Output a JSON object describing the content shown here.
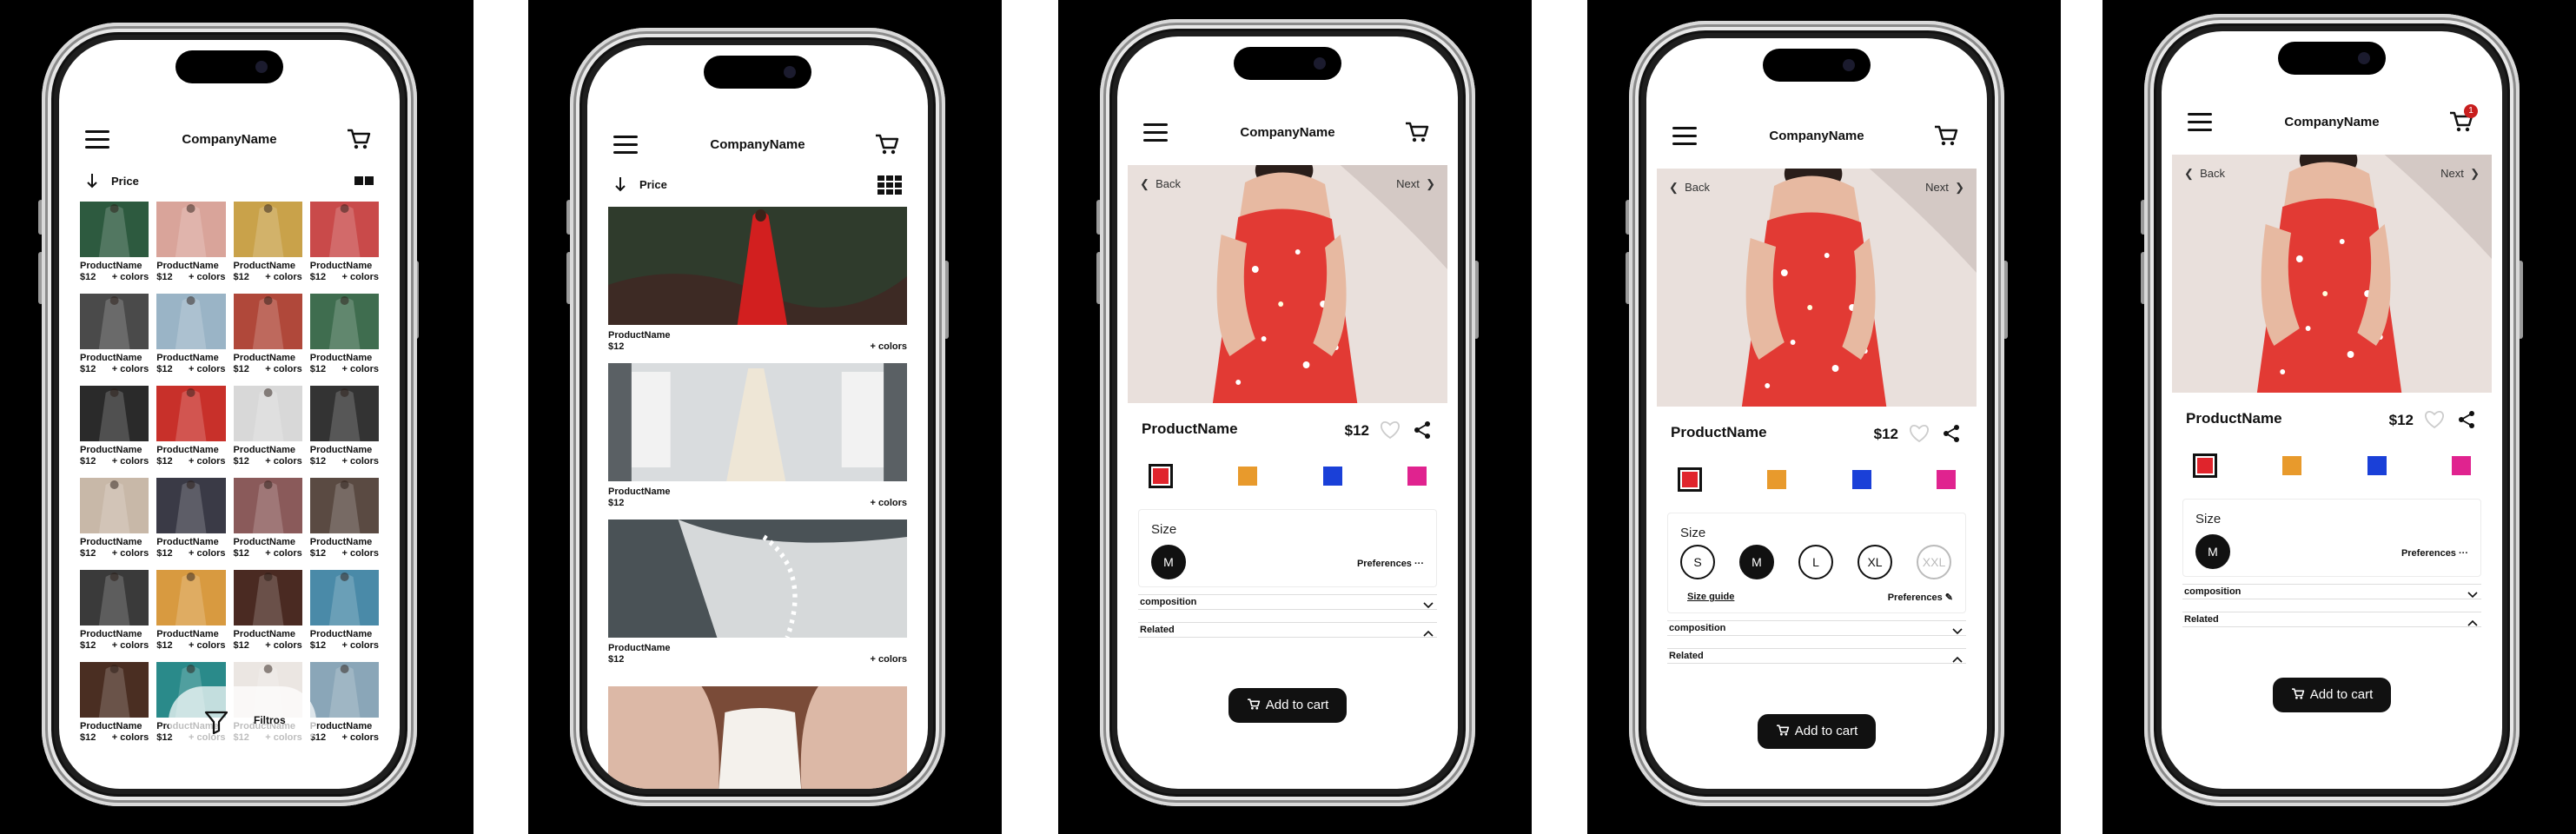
{
  "app": {
    "company": "CompanyName"
  },
  "colors": {
    "red": "#e0242c",
    "orange": "#e89a2c",
    "blue": "#1a40d8",
    "pink": "#e0238f"
  },
  "catalog": {
    "sort_label": "Price",
    "filter_label": "Filtros",
    "rows": [
      [
        {
          "name": "ProductName",
          "price": "$12",
          "colors": "+ colors",
          "bg": "#2d5a3f"
        },
        {
          "name": "ProductName",
          "price": "$12",
          "colors": "+ colors",
          "bg": "#d9a49a"
        },
        {
          "name": "ProductName",
          "price": "$12",
          "colors": "+ colors",
          "bg": "#c9a24a"
        },
        {
          "name": "ProductName",
          "price": "$12",
          "colors": "+ colors",
          "bg": "#c94a4a"
        }
      ],
      [
        {
          "name": "ProductName",
          "price": "$12",
          "colors": "+ colors",
          "bg": "#4a4a4a"
        },
        {
          "name": "ProductName",
          "price": "$12",
          "colors": "+ colors",
          "bg": "#9ab4c6"
        },
        {
          "name": "ProductName",
          "price": "$12",
          "colors": "+ colors",
          "bg": "#b0483a"
        },
        {
          "name": "ProductName",
          "price": "$12",
          "colors": "+ colors",
          "bg": "#3f6d4f"
        }
      ],
      [
        {
          "name": "ProductName",
          "price": "$12",
          "colors": "+ colors",
          "bg": "#2a2a2a"
        },
        {
          "name": "ProductName",
          "price": "$12",
          "colors": "+ colors",
          "bg": "#c8302a"
        },
        {
          "name": "ProductName",
          "price": "$12",
          "colors": "+ colors",
          "bg": "#d8d8d8"
        },
        {
          "name": "ProductName",
          "price": "$12",
          "colors": "+ colors",
          "bg": "#333333"
        }
      ],
      [
        {
          "name": "ProductName",
          "price": "$12",
          "colors": "+ colors",
          "bg": "#c8b8a8"
        },
        {
          "name": "ProductName",
          "price": "$12",
          "colors": "+ colors",
          "bg": "#3a3a46"
        },
        {
          "name": "ProductName",
          "price": "$12",
          "colors": "+ colors",
          "bg": "#8a5a5a"
        },
        {
          "name": "ProductName",
          "price": "$12",
          "colors": "+ colors",
          "bg": "#5a4a42"
        }
      ],
      [
        {
          "name": "ProductName",
          "price": "$12",
          "colors": "+ colors",
          "bg": "#3a3a3a"
        },
        {
          "name": "ProductName",
          "price": "$12",
          "colors": "+ colors",
          "bg": "#d89a40"
        },
        {
          "name": "ProductName",
          "price": "$12",
          "colors": "+ colors",
          "bg": "#4a2a22"
        },
        {
          "name": "ProductName",
          "price": "$12",
          "colors": "+ colors",
          "bg": "#4a8aa8"
        }
      ],
      [
        {
          "name": "ProductName",
          "price": "$12",
          "colors": "+ colors",
          "bg": "#4a2e22"
        },
        {
          "name": "ProductName",
          "price": "$12",
          "colors": "+ colors",
          "bg": "#2a8a8a"
        },
        {
          "name": "ProductName",
          "price": "$12",
          "colors": "+ colors",
          "bg": "#ebe6e2"
        },
        {
          "name": "ProductName",
          "price": "$12",
          "colors": "+ colors",
          "bg": "#8aa6b8"
        }
      ]
    ]
  },
  "list": {
    "sort_label": "Price",
    "items": [
      {
        "name": "ProductName",
        "price": "$12",
        "colors": "+ colors",
        "bg": "#2e3a2a"
      },
      {
        "name": "ProductName",
        "price": "$12",
        "colors": "+ colors",
        "bg": "#c8ccd0"
      },
      {
        "name": "ProductName",
        "price": "$12",
        "colors": "+ colors",
        "bg": "#4a5256"
      }
    ]
  },
  "detail": {
    "back": "Back",
    "next": "Next",
    "name": "ProductName",
    "price": "$12",
    "size_title": "Size",
    "preferences": "Preferences",
    "size_guide": "Size guide",
    "sizes": [
      "S",
      "M",
      "L",
      "XL",
      "XXL"
    ],
    "selected_size": "M",
    "composition": "composition",
    "related": "Related",
    "add_to_cart": "Add to cart",
    "cart_count": "1"
  }
}
